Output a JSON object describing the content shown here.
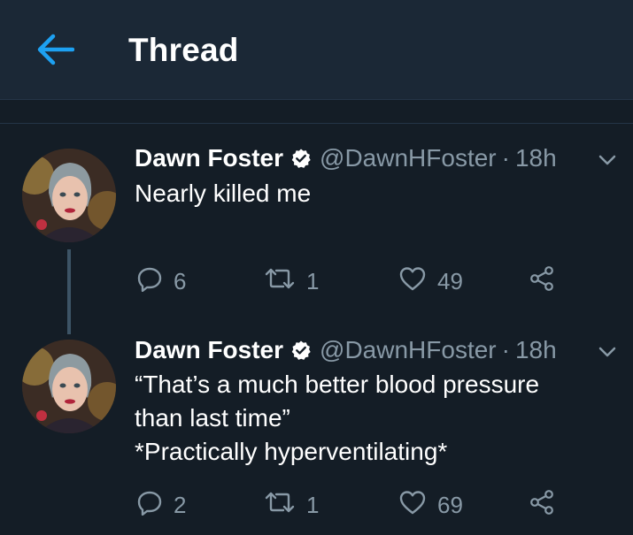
{
  "header": {
    "title": "Thread",
    "back_icon": "arrow-left-icon",
    "accent": "#1da1f2"
  },
  "colors": {
    "background": "#141d26",
    "header_bg": "#1b2836",
    "muted": "#8899a6",
    "text": "#ffffff"
  },
  "tweets": [
    {
      "name": "Dawn Foster",
      "verified": true,
      "handle": "@DawnHFoster",
      "separator": "·",
      "time": "18h",
      "lines": [
        "Nearly killed me"
      ],
      "replies": "6",
      "retweets": "1",
      "likes": "49"
    },
    {
      "name": "Dawn Foster",
      "verified": true,
      "handle": "@DawnHFoster",
      "separator": "·",
      "time": "18h",
      "lines": [
        "“That’s a much better blood pressure",
        "than last time”",
        "*Practically hyperventilating*"
      ],
      "replies": "2",
      "retweets": "1",
      "likes": "69"
    }
  ]
}
